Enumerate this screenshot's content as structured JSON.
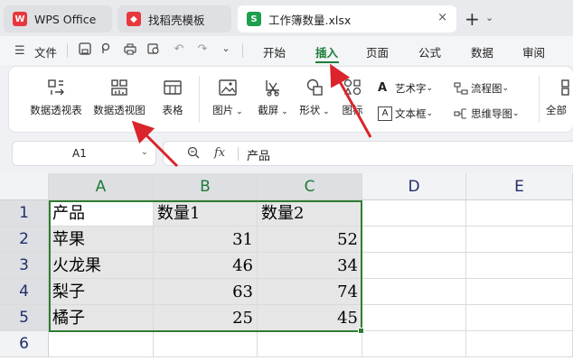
{
  "tabs": [
    {
      "label": "WPS Office",
      "icon": "wps-logo-icon"
    },
    {
      "label": "找稻壳模板",
      "icon": "docer-logo-icon"
    },
    {
      "label": "工作簿数量.xlsx",
      "icon": "spreadsheet-icon",
      "close": "×"
    }
  ],
  "menu": {
    "file": "文件",
    "tabs": [
      "开始",
      "插入",
      "页面",
      "公式",
      "数据",
      "审阅"
    ],
    "active_tab": "插入"
  },
  "ribbon": {
    "pivot_table": "数据透视表",
    "pivot_chart": "数据透视图",
    "table": "表格",
    "picture": "图片",
    "screenshot": "截屏",
    "shape": "形状",
    "icon": "图标",
    "wordart": "艺术字",
    "textbox": "文本框",
    "flowchart": "流程图",
    "mindmap": "思维导图",
    "all": "全部"
  },
  "formula_bar": {
    "name_box": "A1",
    "fx": "fx",
    "value": "产品"
  },
  "sheet": {
    "columns": [
      "A",
      "B",
      "C",
      "D",
      "E"
    ],
    "rows": [
      "1",
      "2",
      "3",
      "4",
      "5",
      "6"
    ],
    "header": [
      "产品",
      "数量1",
      "数量2"
    ],
    "data": [
      [
        "苹果",
        "31",
        "52"
      ],
      [
        "火龙果",
        "46",
        "34"
      ],
      [
        "梨子",
        "63",
        "74"
      ],
      [
        "橘子",
        "25",
        "45"
      ]
    ]
  },
  "colors": {
    "accent": "#1a7f37",
    "selection_border": "#2e7d32",
    "arrow": "#d9252b"
  }
}
